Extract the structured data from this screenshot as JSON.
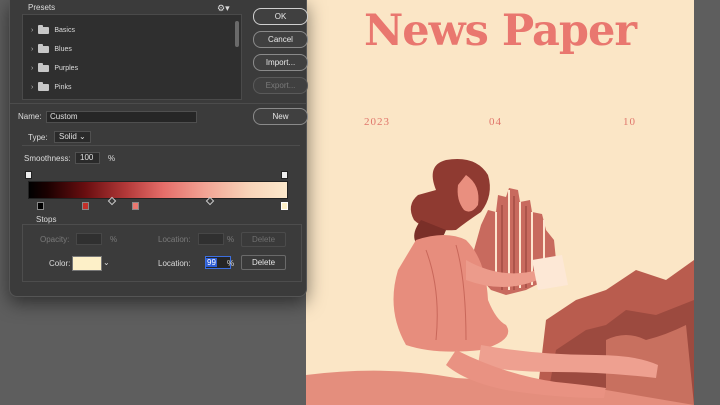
{
  "document": {
    "title": "News Paper",
    "date_year": "2023",
    "date_month": "04",
    "date_day": "10"
  },
  "dialog": {
    "presets_label": "Presets",
    "presets_menu_icon": "gear-icon",
    "presets": [
      "Basics",
      "Blues",
      "Purples",
      "Pinks"
    ],
    "buttons": {
      "ok": "OK",
      "cancel": "Cancel",
      "import": "Import...",
      "export": "Export...",
      "new": "New"
    },
    "name_label": "Name:",
    "name_value": "Custom",
    "type_label": "Type:",
    "type_value": "Solid",
    "smoothness_label": "Smoothness:",
    "smoothness_value": "100",
    "smoothness_unit": "%",
    "stops_label": "Stops",
    "opacity_label": "Opacity:",
    "opacity_unit": "%",
    "opacity_location_label": "Location:",
    "opacity_location_unit": "%",
    "opacity_delete": "Delete",
    "color_label": "Color:",
    "color_value": "#fdf0c8",
    "color_location_label": "Location:",
    "color_location_value": "99",
    "color_location_unit": "%",
    "color_delete": "Delete"
  },
  "colors": {
    "title_pink": "#e9776f",
    "paper": "#fbe6c6",
    "dialog_bg": "#3b3b3b",
    "accent_blue": "#2e5ed6"
  }
}
